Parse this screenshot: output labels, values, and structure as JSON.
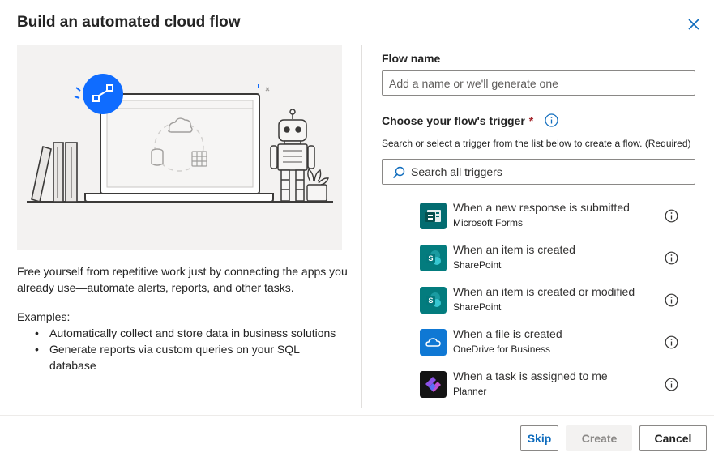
{
  "dialog": {
    "title": "Build an automated cloud flow"
  },
  "left": {
    "description": "Free yourself from repetitive work just by connecting the apps you already use—automate alerts, reports, and other tasks.",
    "examples_label": "Examples:",
    "examples": [
      "Automatically collect and store data in business solutions",
      "Generate reports via custom queries on your SQL database"
    ]
  },
  "form": {
    "flow_name_label": "Flow name",
    "flow_name_placeholder": "Add a name or we'll generate one",
    "flow_name_value": "",
    "trigger_label": "Choose your flow's trigger",
    "required_mark": "*",
    "trigger_hint": "Search or select a trigger from the list below to create a flow. (Required)",
    "search_placeholder": "Search all triggers"
  },
  "triggers": [
    {
      "title": "When a new response is submitted",
      "connector": "Microsoft Forms",
      "icon": "microsoft-forms-icon",
      "color": "#036c70"
    },
    {
      "title": "When an item is created",
      "connector": "SharePoint",
      "icon": "sharepoint-icon",
      "color": "#037c7e"
    },
    {
      "title": "When an item is created or modified",
      "connector": "SharePoint",
      "icon": "sharepoint-icon",
      "color": "#037c7e"
    },
    {
      "title": "When a file is created",
      "connector": "OneDrive for Business",
      "icon": "onedrive-icon",
      "color": "#0f78d4"
    },
    {
      "title": "When a task is assigned to me",
      "connector": "Planner",
      "icon": "planner-icon",
      "color": "#141414"
    }
  ],
  "footer": {
    "skip_label": "Skip",
    "create_label": "Create",
    "cancel_label": "Cancel"
  },
  "colors": {
    "accent": "#0f6cbd",
    "required": "#a4262c",
    "hero_bg": "#f3f2f1",
    "flow_badge": "#0f6cff"
  }
}
